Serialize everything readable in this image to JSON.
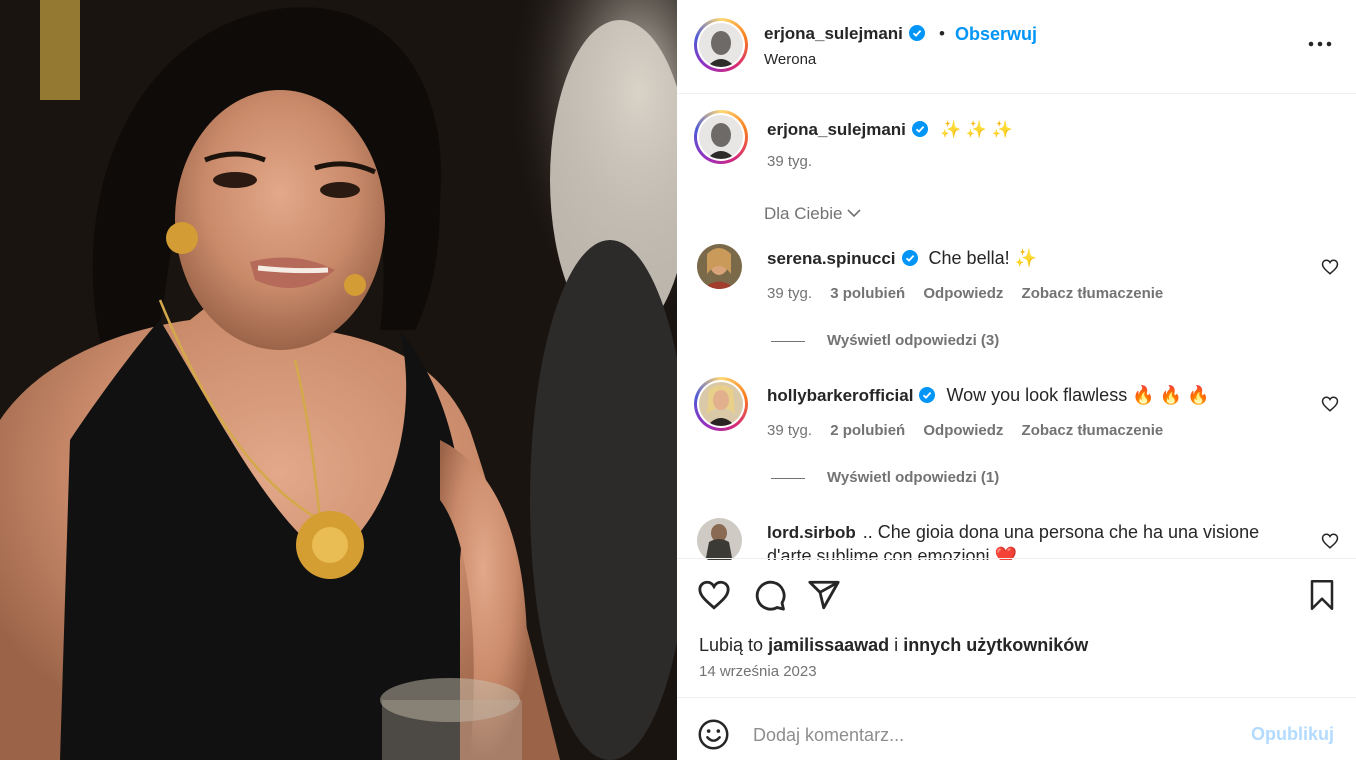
{
  "post": {
    "username": "erjona_sulejmani",
    "follow_label": "Obserwuj",
    "separator": "•",
    "location": "Werona",
    "caption_text": "✨ ✨ ✨",
    "caption_time": "39 tyg.",
    "filter_label": "Dla Ciebie"
  },
  "comments": [
    {
      "username": "serena.spinucci",
      "text": "Che bella! ✨",
      "time": "39 tyg.",
      "likes": "3 polubień",
      "reply": "Odpowiedz",
      "translate": "Zobacz tłumaczenie",
      "replies_label": "Wyświetl odpowiedzi (3)"
    },
    {
      "username": "hollybarkerofficial",
      "text": "Wow you look flawless 🔥 🔥 🔥",
      "time": "39 tyg.",
      "likes": "2 polubień",
      "reply": "Odpowiedz",
      "translate": "Zobacz tłumaczenie",
      "replies_label": "Wyświetl odpowiedzi (1)"
    },
    {
      "username": "lord.sirbob",
      "text": ".. Che gioia dona una persona che ha una visione",
      "text2": "d'arte sublime con emozioni ❤️"
    }
  ],
  "footer": {
    "likes_prefix": "Lubią to",
    "likes_user": "jamilissaawad",
    "likes_mid": "i",
    "likes_suffix": "innych użytkowników",
    "date": "14 września 2023",
    "comment_placeholder": "Dodaj komentarz...",
    "publish_label": "Opublikuj"
  },
  "icons": {
    "verified": "verified-badge-icon",
    "more": "more-options-icon",
    "like": "heart-icon",
    "comment": "comment-icon",
    "share": "share-icon",
    "save": "bookmark-icon",
    "emoji": "emoji-icon"
  },
  "colors": {
    "accent": "#0095f6",
    "publish_disabled": "#b3dbff",
    "muted": "#737373"
  }
}
